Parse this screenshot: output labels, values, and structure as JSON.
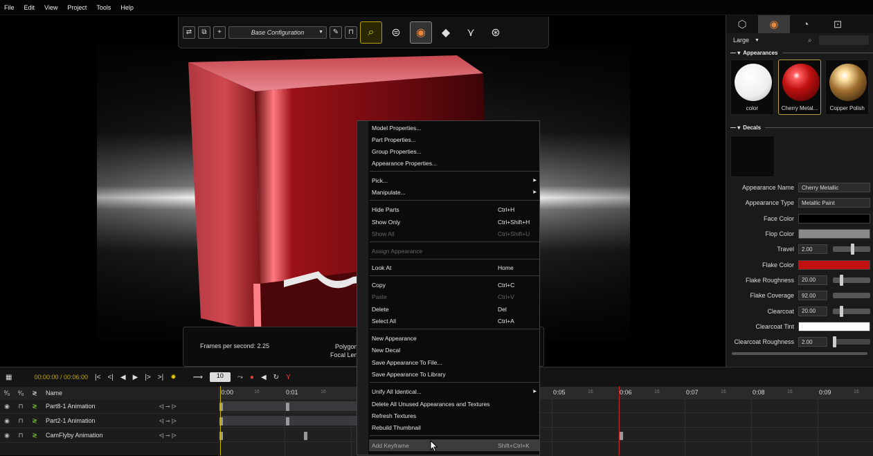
{
  "menubar": [
    "File",
    "Edit",
    "View",
    "Project",
    "Tools",
    "Help"
  ],
  "toolbar": {
    "configuration": "Base Configuration"
  },
  "viewport_info": {
    "fps": "Frames per second: 2.25",
    "polygon": "Polygon",
    "focal": "Focal Len"
  },
  "right_panel": {
    "size_select": "Large",
    "appearances_header": "Appearances",
    "decals_header": "Decals",
    "swatches": [
      "color",
      "Cherry Metal...",
      "Copper Polish"
    ],
    "props": {
      "appearance_name_label": "Appearance Name",
      "appearance_name": "Cherry Metallic",
      "appearance_type_label": "Appearance Type",
      "appearance_type": "Metallic Paint",
      "face_color_label": "Face Color",
      "flop_color_label": "Flop Color",
      "travel_label": "Travel",
      "travel": "2.00",
      "flake_color_label": "Flake Color",
      "flake_roughness_label": "Flake Roughness",
      "flake_roughness": "20.00",
      "flake_coverage_label": "Flake Coverage",
      "flake_coverage": "92.00",
      "clearcoat_label": "Clearcoat",
      "clearcoat": "20.00",
      "clearcoat_tint_label": "Clearcoat Tint",
      "clearcoat_roughness_label": "Clearcoat Roughness",
      "clearcoat_roughness": "2.00"
    },
    "colors": {
      "face": "#000000",
      "flop": "#8a8a8a",
      "flake": "#c01010",
      "tint": "#ffffff"
    }
  },
  "timeline": {
    "time": "00:00:00 / 00:06:00",
    "frame": "10",
    "name_header": "Name",
    "rows": [
      "Part8-1 Animation",
      "Part2-1 Animation",
      "CamFlyby Animation"
    ],
    "ruler": [
      ":0:00",
      "0:01",
      "0:05",
      "0:06",
      "0:07",
      "0:08",
      "0:09"
    ],
    "ruler_sub": "16"
  },
  "context_menu": {
    "items": [
      "Model Properties...",
      "Part Properties...",
      "Group Properties...",
      "Appearance Properties...",
      "Pick...",
      "Manipulate...",
      "Hide Parts",
      "Show Only",
      "Show All",
      "Assign Appearance",
      "Look At",
      "Copy",
      "Paste",
      "Delete",
      "Select All",
      "New Appearance",
      "New Decal",
      "Save Appearance To File...",
      "Save Appearance To Library",
      "Unify All Identical...",
      "Delete All Unused Appearances and Textures",
      "Refresh Textures",
      "Rebuild Thumbnail",
      "Add Keyframe"
    ],
    "shortcuts": {
      "hide": "Ctrl+H",
      "show_only": "Ctrl+Shift+H",
      "show_all": "Ctrl+Shift+U",
      "look_at": "Home",
      "copy": "Ctrl+C",
      "paste": "Ctrl+V",
      "delete": "Del",
      "select_all": "Ctrl+A",
      "add_keyframe": "Shift+Ctrl+K"
    }
  }
}
